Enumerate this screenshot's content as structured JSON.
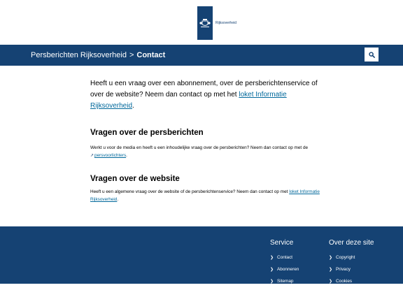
{
  "header": {
    "logo_text": "Rijksoverheid"
  },
  "navbar": {
    "breadcrumb_root": "Persberichten Rijksoverheid",
    "breadcrumb_separator": ">",
    "breadcrumb_current": "Contact",
    "search_icon": "search-icon"
  },
  "intro": {
    "text": "Heeft u een vraag over een abonnement, over de persberichtenservice of over de website?  Neem dan contact op met het ",
    "link": "loket Informatie Rijksoverheid",
    "after": "."
  },
  "section_persberichten": {
    "title": "Vragen over de persberichten",
    "text": "Werkt u voor de media en heeft u een inhoudelijke vraag over de persberichten? Neem dan contact op met de ",
    "link": "persvoorlichters",
    "after": "."
  },
  "section_website": {
    "title": "Vragen over de website",
    "text": "Heeft u een algemene vraag over de website of de persberichtenservice? Neem dan contact op met ",
    "link": "loket Informatie Rijksoverheid",
    "after": "."
  },
  "footer": {
    "service": {
      "title": "Service",
      "items": [
        "Contact",
        "Abonneren",
        "Sitemap"
      ]
    },
    "about": {
      "title": "Over deze site",
      "items": [
        "Copyright",
        "Privacy",
        "Cookies"
      ]
    }
  },
  "colors": {
    "brand_blue": "#154273",
    "link_blue": "#01689b"
  }
}
